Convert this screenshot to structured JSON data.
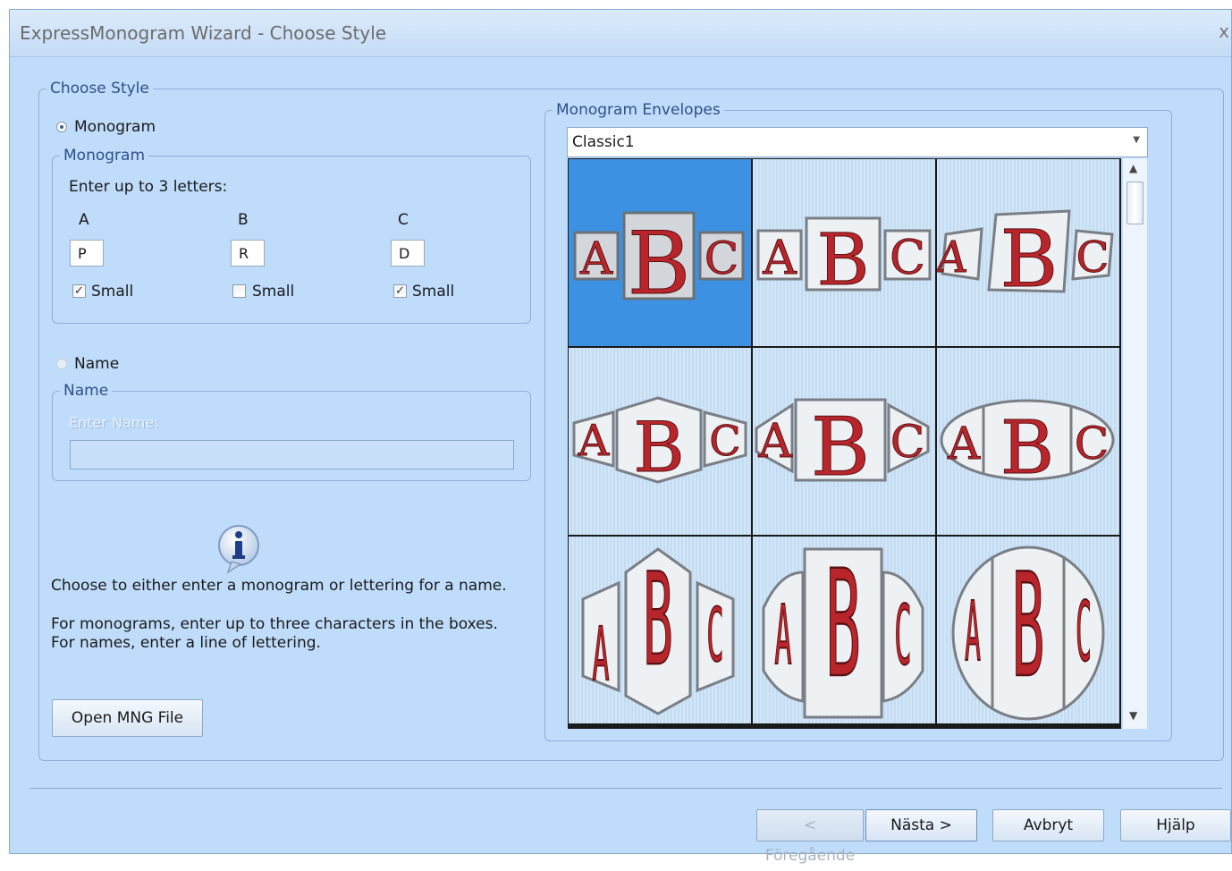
{
  "window": {
    "title": "ExpressMonogram Wizard - Choose Style",
    "close_glyph": "x"
  },
  "choose_style": {
    "legend": "Choose Style",
    "monogram_radio": {
      "label": "Monogram",
      "checked": true
    },
    "monogram_group": {
      "legend": "Monogram",
      "prompt": "Enter up to 3 letters:",
      "letters": [
        {
          "header": "A",
          "value": "P",
          "small_label": "Small",
          "small_checked": true
        },
        {
          "header": "B",
          "value": "R",
          "small_label": "Small",
          "small_checked": false
        },
        {
          "header": "C",
          "value": "D",
          "small_label": "Small",
          "small_checked": true
        }
      ]
    },
    "name_radio": {
      "label": "Name",
      "checked": false
    },
    "name_group": {
      "legend": "Name",
      "prompt": "Enter Name:",
      "value": ""
    },
    "help": {
      "line1": "Choose to either enter a monogram or lettering for a name.",
      "line2": "For monograms, enter up to three characters in the boxes.",
      "line3": "For names, enter a line of lettering."
    },
    "open_mng_label": "Open MNG File"
  },
  "envelopes": {
    "legend": "Monogram Envelopes",
    "selected": "Classic1",
    "thumbnails": [
      {
        "label": "ABC",
        "style": "rect-tiles",
        "selected": true
      },
      {
        "label": "ABC",
        "style": "rect-tiles-wide",
        "selected": false
      },
      {
        "label": "ABC",
        "style": "rect-tiles-slanted",
        "selected": false
      },
      {
        "label": "ABC",
        "style": "diamond",
        "selected": false
      },
      {
        "label": "ABC",
        "style": "diamond-wide",
        "selected": false
      },
      {
        "label": "ABC",
        "style": "oval",
        "selected": false
      },
      {
        "label": "ABC",
        "style": "tall-hexagon",
        "selected": false
      },
      {
        "label": "ABC",
        "style": "tall-arch",
        "selected": false
      },
      {
        "label": "ABC",
        "style": "tall-oval",
        "selected": false
      }
    ],
    "colors": {
      "letter_fill": "#b8262b",
      "outline": "#8a8f96",
      "selected_bg": "#3d91e2"
    }
  },
  "footer": {
    "back_label": "< Föregående",
    "next_label": "Nästa >",
    "cancel_label": "Avbryt",
    "help_label": "Hjälp"
  }
}
